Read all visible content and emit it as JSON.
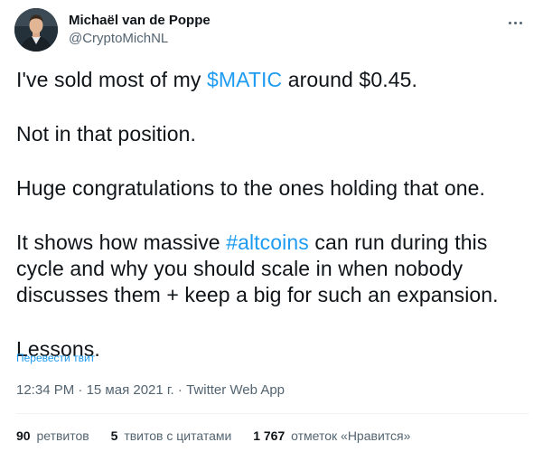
{
  "author": {
    "display_name": "Michaël van de Poppe",
    "handle": "@CryptoMichNL"
  },
  "tweet": {
    "p1_before": "I've sold most of my ",
    "p1_tag": "$MATIC",
    "p1_after": " around $0.45.",
    "p2": "Not in that position.",
    "p3": "Huge congratulations to the ones holding that one.",
    "p4_before": "It shows how massive ",
    "p4_tag": "#altcoins",
    "p4_after": " can run during this cycle and why you should scale in when nobody discusses them + keep a big for such an expansion.",
    "p5": "Lessons."
  },
  "translate_label": "Перевести твит",
  "meta": {
    "time": "12:34 PM",
    "sep": " · ",
    "date": "15 мая 2021 г.",
    "source": "Twitter Web App"
  },
  "stats": {
    "retweets_count": "90",
    "retweets_label": "ретвитов",
    "quotes_count": "5",
    "quotes_label": "твитов с цитатами",
    "likes_count": "1 767",
    "likes_label": "отметок «Нравится»"
  },
  "colors": {
    "accent": "#1d9bf0",
    "text": "#0f1419",
    "secondary": "#536471"
  },
  "icons": {
    "more": "more-horizontal-icon"
  }
}
